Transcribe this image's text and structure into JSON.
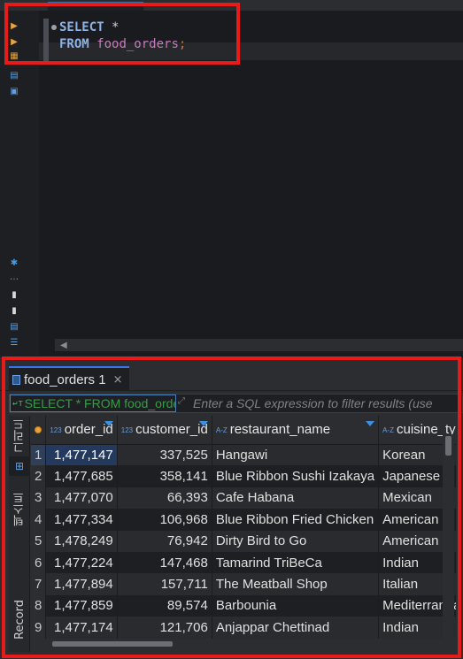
{
  "editor": {
    "line1_keyword": "SELECT",
    "line1_rest": " *",
    "line2_keyword": "FROM",
    "line2_table": "food_orders",
    "line2_end": ";"
  },
  "results": {
    "tab_label": "food_orders 1",
    "tab_close": "×",
    "filter": {
      "query_text": "SELECT * FROM food_orders",
      "placeholder": "Enter a SQL expression to filter results (use"
    },
    "side_tabs": {
      "grid": "그리드",
      "text": "텍스트",
      "record": "Record"
    },
    "columns": [
      {
        "type_icon": "123",
        "name": "order_id"
      },
      {
        "type_icon": "123",
        "name": "customer_id"
      },
      {
        "type_icon": "A-Z",
        "name": "restaurant_name"
      },
      {
        "type_icon": "A-Z",
        "name": "cuisine_type"
      }
    ],
    "rows": [
      {
        "n": "1",
        "order_id": "1,477,147",
        "customer_id": "337,525",
        "restaurant": "Hangawi",
        "cuisine": "Korean"
      },
      {
        "n": "2",
        "order_id": "1,477,685",
        "customer_id": "358,141",
        "restaurant": "Blue Ribbon Sushi Izakaya",
        "cuisine": "Japanese"
      },
      {
        "n": "3",
        "order_id": "1,477,070",
        "customer_id": "66,393",
        "restaurant": "Cafe Habana",
        "cuisine": "Mexican"
      },
      {
        "n": "4",
        "order_id": "1,477,334",
        "customer_id": "106,968",
        "restaurant": "Blue Ribbon Fried Chicken",
        "cuisine": "American"
      },
      {
        "n": "5",
        "order_id": "1,478,249",
        "customer_id": "76,942",
        "restaurant": "Dirty Bird to Go",
        "cuisine": "American"
      },
      {
        "n": "6",
        "order_id": "1,477,224",
        "customer_id": "147,468",
        "restaurant": "Tamarind TriBeCa",
        "cuisine": "Indian"
      },
      {
        "n": "7",
        "order_id": "1,477,894",
        "customer_id": "157,711",
        "restaurant": "The Meatball Shop",
        "cuisine": "Italian"
      },
      {
        "n": "8",
        "order_id": "1,477,859",
        "customer_id": "89,574",
        "restaurant": "Barbounia",
        "cuisine": "Mediterranean"
      },
      {
        "n": "9",
        "order_id": "1,477,174",
        "customer_id": "121,706",
        "restaurant": "Anjappar Chettinad",
        "cuisine": "Indian"
      }
    ]
  },
  "colors": {
    "highlight_border": "#e81b1b",
    "keyword": "#8fb3e6",
    "table_identifier": "#c77dbb",
    "selected_cell": "#23395e"
  }
}
